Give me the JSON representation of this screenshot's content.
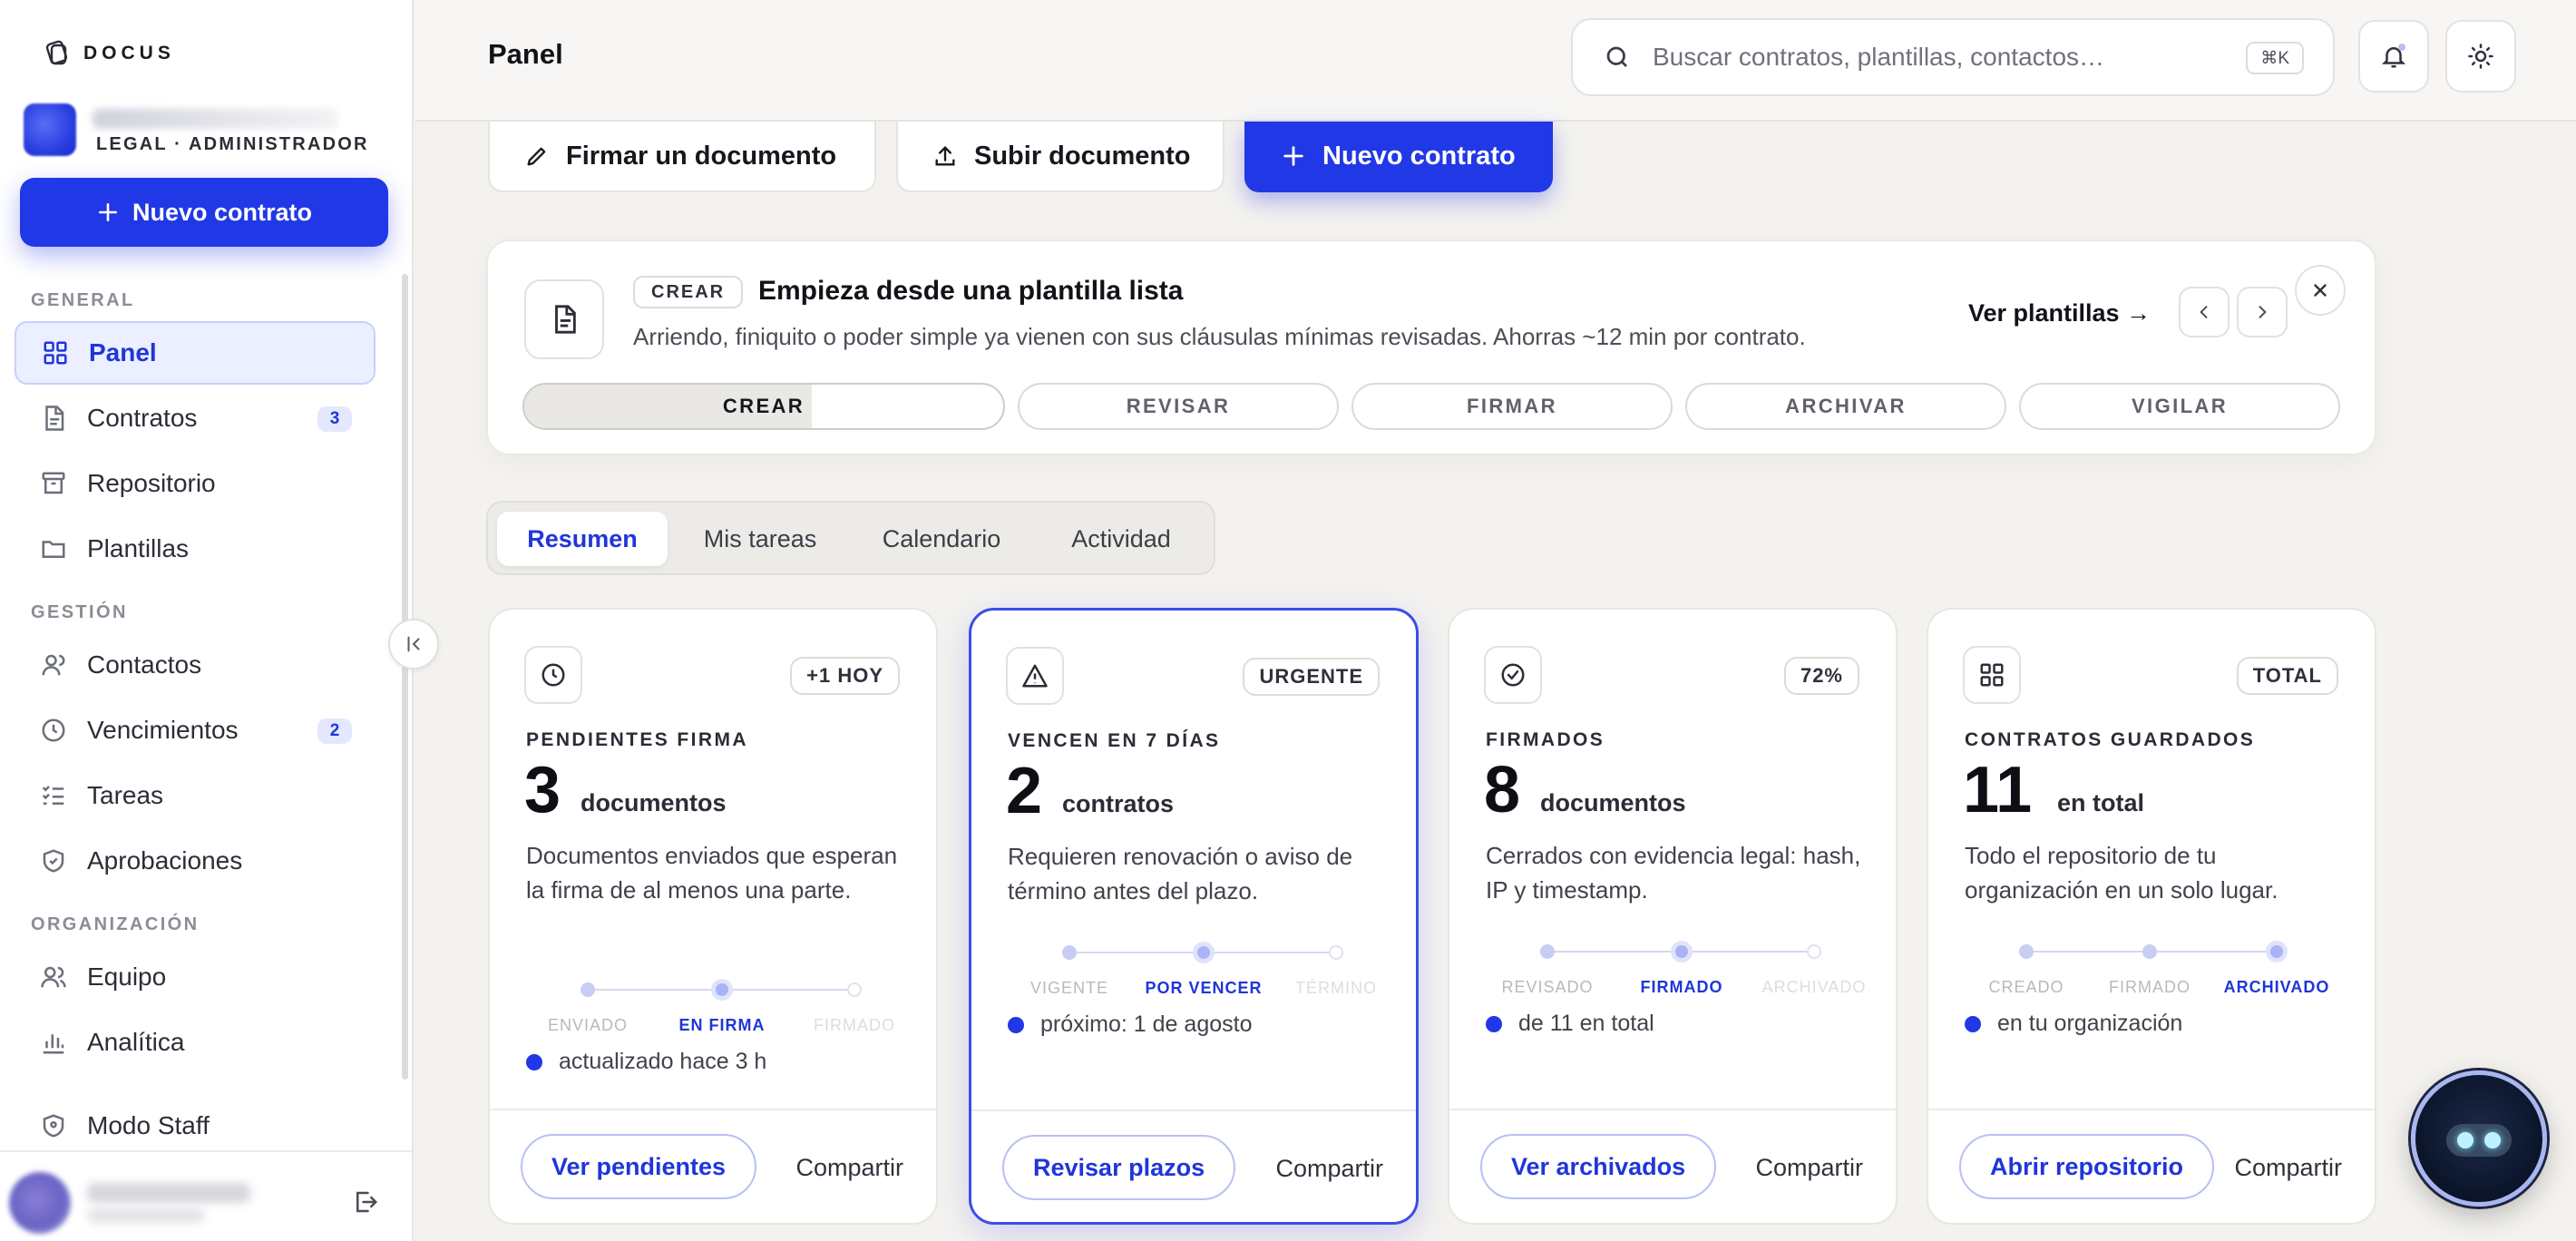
{
  "brand": {
    "name": "DOCUS"
  },
  "org": {
    "role": "LEGAL · ADMINISTRADOR"
  },
  "sidebar": {
    "new_contract_label": "Nuevo contrato",
    "sections": {
      "general": "GENERAL",
      "gestion": "GESTIÓN",
      "organizacion": "ORGANIZACIÓN"
    },
    "items": {
      "panel": {
        "label": "Panel",
        "icon": "grid-icon"
      },
      "contratos": {
        "label": "Contratos",
        "badge": "3",
        "icon": "document-icon"
      },
      "repositorio": {
        "label": "Repositorio",
        "icon": "archive-icon"
      },
      "plantillas": {
        "label": "Plantillas",
        "icon": "folder-icon"
      },
      "contactos": {
        "label": "Contactos",
        "icon": "user-icon"
      },
      "vencimientos": {
        "label": "Vencimientos",
        "badge": "2",
        "icon": "clock-icon"
      },
      "tareas": {
        "label": "Tareas",
        "icon": "checklist-icon"
      },
      "aprobaciones": {
        "label": "Aprobaciones",
        "icon": "shield-check-icon"
      },
      "equipo": {
        "label": "Equipo",
        "icon": "users-icon"
      },
      "analitica": {
        "label": "Analítica",
        "icon": "bar-chart-icon"
      },
      "modo_staff": {
        "label": "Modo Staff",
        "icon": "shield-icon"
      }
    }
  },
  "header": {
    "title": "Panel",
    "search_placeholder": "Buscar contratos, plantillas, contactos…",
    "search_shortcut": "⌘K"
  },
  "actions": {
    "sign": "Firmar un documento",
    "upload": "Subir documento",
    "new_contract": "Nuevo contrato"
  },
  "banner": {
    "tag": "CREAR",
    "title": "Empieza desde una plantilla lista",
    "description": "Arriendo, finiquito o poder simple ya vienen con sus cláusulas mínimas revisadas. Ahorras ~12 min por contrato.",
    "link": "Ver plantillas →",
    "steps": [
      "CREAR",
      "REVISAR",
      "FIRMAR",
      "ARCHIVAR",
      "VIGILAR"
    ],
    "active_step_progress": 0.6
  },
  "tabs": [
    "Resumen",
    "Mis tareas",
    "Calendario",
    "Actividad"
  ],
  "cards": [
    {
      "badge": "+1 HOY",
      "label": "PENDIENTES FIRMA",
      "value": "3",
      "unit": "documentos",
      "desc": "Documentos enviados que esperan la firma de al menos una parte.",
      "timeline": [
        "ENVIADO",
        "EN FIRMA",
        "FIRMADO"
      ],
      "foot": "actualizado hace 3 h",
      "button": "Ver pendientes",
      "share": "Compartir"
    },
    {
      "badge": "URGENTE",
      "label": "VENCEN EN 7 DÍAS",
      "value": "2",
      "unit": "contratos",
      "desc": "Requieren renovación o aviso de término antes del plazo.",
      "timeline": [
        "VIGENTE",
        "POR VENCER",
        "TÉRMINO"
      ],
      "foot": "próximo: 1 de agosto",
      "button": "Revisar plazos",
      "share": "Compartir"
    },
    {
      "badge": "72%",
      "label": "FIRMADOS",
      "value": "8",
      "unit": "documentos",
      "desc": "Cerrados con evidencia legal: hash, IP y timestamp.",
      "timeline": [
        "REVISADO",
        "FIRMADO",
        "ARCHIVADO"
      ],
      "foot": "de 11 en total",
      "button": "Ver archivados",
      "share": "Compartir"
    },
    {
      "badge": "TOTAL",
      "label": "CONTRATOS GUARDADOS",
      "value": "11",
      "unit": "en total",
      "desc": "Todo el repositorio de tu organización en un solo lugar.",
      "timeline": [
        "CREADO",
        "FIRMADO",
        "ARCHIVADO"
      ],
      "foot": "en tu organización",
      "button": "Abrir repositorio",
      "share": "Compartir"
    }
  ],
  "colors": {
    "accent": "#2138e6",
    "accent_light": "#ecefff"
  }
}
